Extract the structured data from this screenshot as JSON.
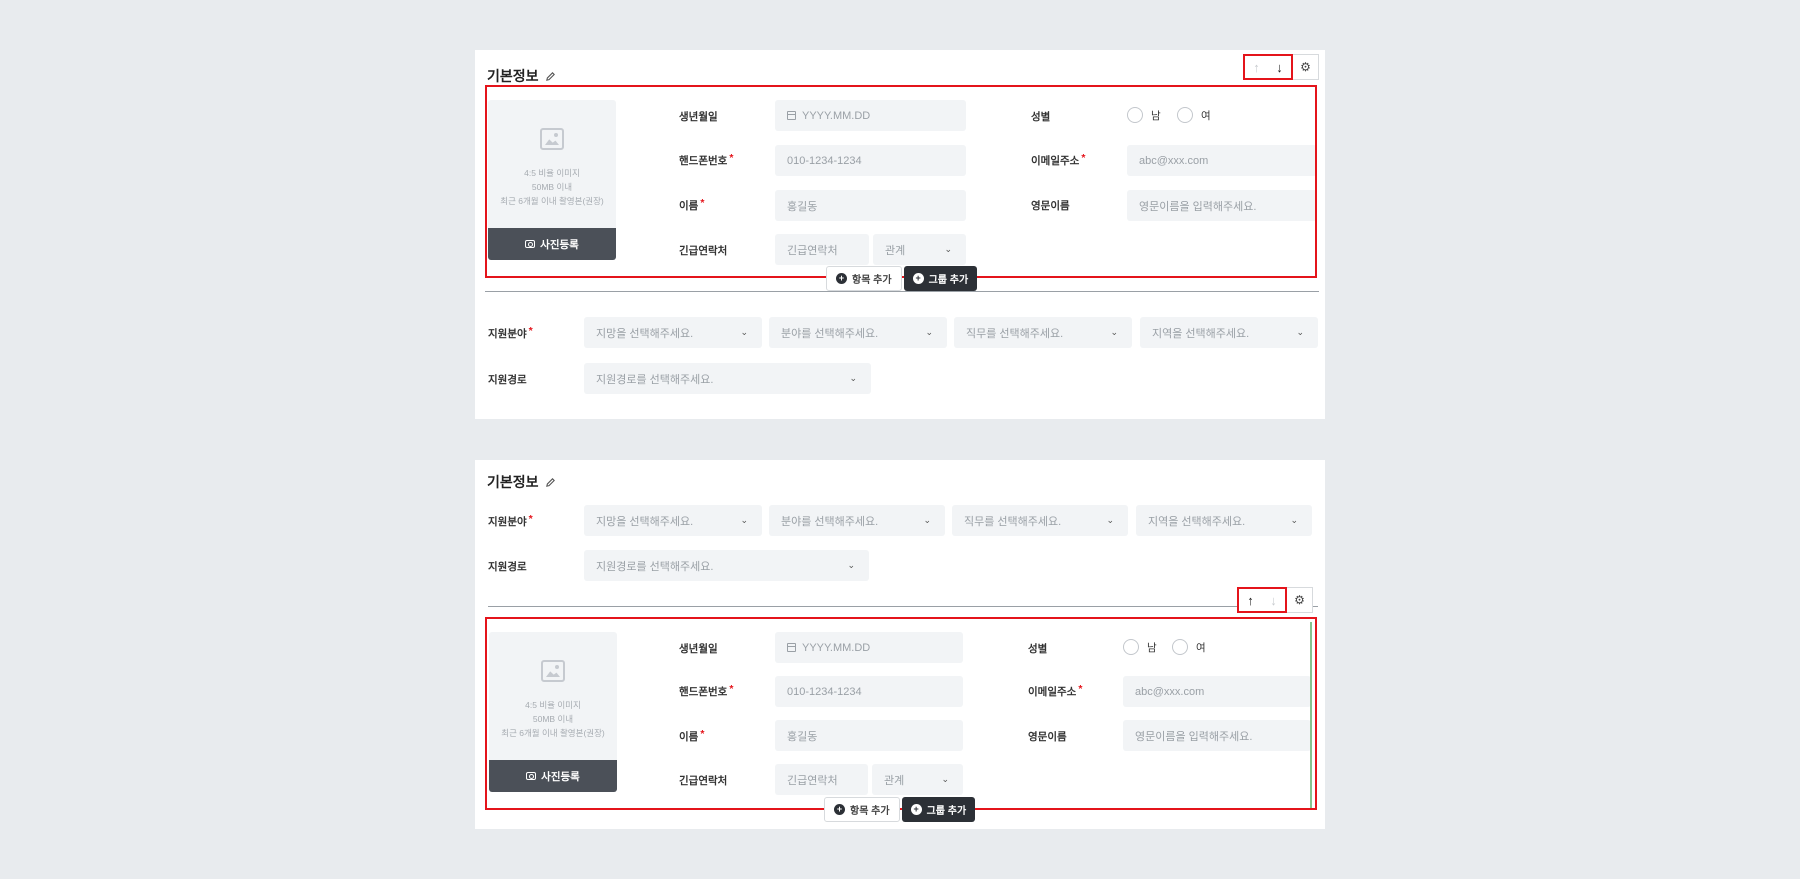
{
  "section_title": "기본정보",
  "controls": {
    "up_icon": "↑",
    "down_icon": "↓",
    "gear_icon": "⚙"
  },
  "photo": {
    "hint_lines": [
      "4:5 비율 이미지",
      "50MB 이내",
      "최근 6개월 이내 촬영본(권장)"
    ],
    "upload_label": "사진등록"
  },
  "fields": {
    "birth": {
      "label": "생년월일",
      "placeholder": "YYYY.MM.DD"
    },
    "phone": {
      "label": "핸드폰번호",
      "placeholder": "010-1234-1234"
    },
    "name": {
      "label": "이름",
      "placeholder": "홍길동"
    },
    "emergency": {
      "label": "긴급연락처",
      "placeholder": "긴급연락처",
      "relation": "관계"
    },
    "gender": {
      "label": "성별",
      "male": "남",
      "female": "여"
    },
    "email": {
      "label": "이메일주소",
      "placeholder": "abc@xxx.com"
    },
    "eng_name": {
      "label": "영문이름",
      "placeholder": "영문이름을 입력해주세요."
    }
  },
  "required_mark": "*",
  "actions": {
    "add_item": "항목 추가",
    "add_group": "그룹 추가"
  },
  "apply": {
    "field_label": "지원분야",
    "selects": [
      "지망을 선택해주세요.",
      "분야를 선택해주세요.",
      "직무를 선택해주세요.",
      "지역을 선택해주세요."
    ],
    "route_label": "지원경로",
    "route_placeholder": "지원경로를 선택해주세요."
  },
  "colors": {
    "highlight": "#e4141b",
    "dark_button": "#2c3036",
    "field_bg": "#f2f4f6",
    "page_bg": "#e8ebee"
  }
}
